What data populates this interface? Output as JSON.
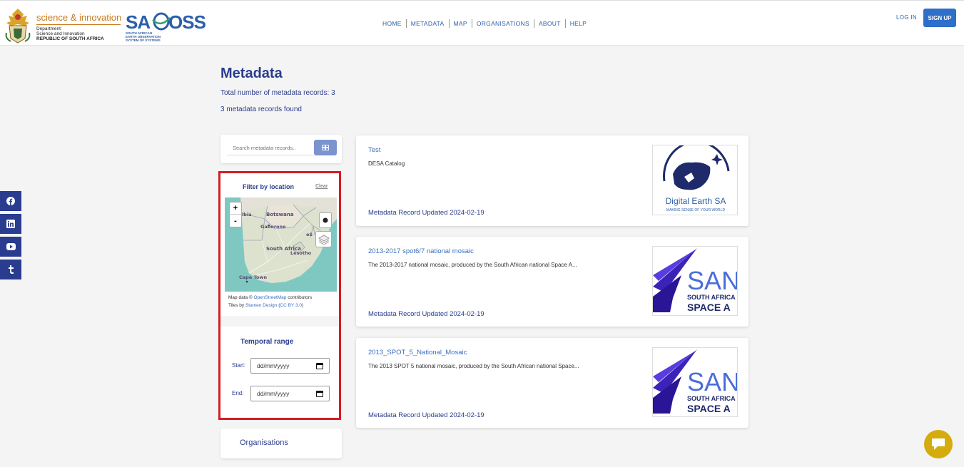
{
  "header": {
    "dst_title": "science & innovation",
    "dst_line1": "Department:",
    "dst_line2": "Science and Innovation",
    "dst_line3": "REPUBLIC OF SOUTH AFRICA",
    "saeoss_name": "SAEOSS",
    "saeoss_sub1": "SOUTH AFRICAN",
    "saeoss_sub2": "EARTH OBSERVATION",
    "saeoss_sub3": "SYSTEM OF SYSTEMS",
    "nav": [
      "HOME",
      "METADATA",
      "MAP",
      "ORGANISATIONS",
      "ABOUT",
      "HELP"
    ],
    "login": "LOG IN",
    "signup": "SIGN UP"
  },
  "page": {
    "title": "Metadata",
    "total": "Total number of metadata records: 3",
    "found": "3 metadata records found"
  },
  "social": [
    "facebook-icon",
    "linkedin-icon",
    "youtube-icon",
    "tumblr-icon"
  ],
  "search": {
    "placeholder": "Search metadata records.."
  },
  "filter": {
    "location_title": "Filter by location",
    "clear": "Clear",
    "zoom_in": "+",
    "zoom_out": "-",
    "map_labels": [
      "Botswana",
      "Gaborone",
      "South Africa",
      "Lesotho",
      "Cape Town",
      "eS",
      "ibia"
    ],
    "attr_prefix1": "Map data © ",
    "attr_link1": "OpenStreetMap",
    "attr_suffix1": " contributors",
    "attr_prefix2": "Tiles by ",
    "attr_link2": "Stamen Design",
    "attr_mid2": " (",
    "attr_link3": "CC BY 3.0",
    "attr_suffix2": ")",
    "temporal_title": "Temporal range",
    "start_label": "Start:",
    "end_label": "End:",
    "date_placeholder": "dd/mm/yyyy",
    "organisations": "Organisations"
  },
  "results": [
    {
      "title": "Test",
      "description": "DESA Catalog",
      "updated": "Metadata Record Updated 2024-02-19",
      "thumb_main": "Digital Earth SA",
      "thumb_sub": "MAKING SENSE OF YOUR WORLD"
    },
    {
      "title": "2013-2017 spot6/7 national mosaic",
      "description": "The 2013-2017 national mosaic, produced by the South African national Space A...",
      "updated": "Metadata Record Updated 2024-02-19",
      "thumb_main": "SAN",
      "thumb_line1": "SOUTH AFRICA",
      "thumb_line2": "SPACE A"
    },
    {
      "title": "2013_SPOT_5_National_Mosaic",
      "description": "The 2013 SPOT 5 national mosaic, produced by the South African national Space...",
      "updated": "Metadata Record Updated 2024-02-19",
      "thumb_main": "SAN",
      "thumb_line1": "SOUTH AFRICA",
      "thumb_line2": "SPACE A"
    }
  ],
  "colors": {
    "brand_blue": "#2a3c8f",
    "link_blue": "#3a6fc0",
    "signup_bg": "#2e6fc9",
    "highlight_red": "#d31d22",
    "chat_yellow": "#d4ac0d"
  }
}
